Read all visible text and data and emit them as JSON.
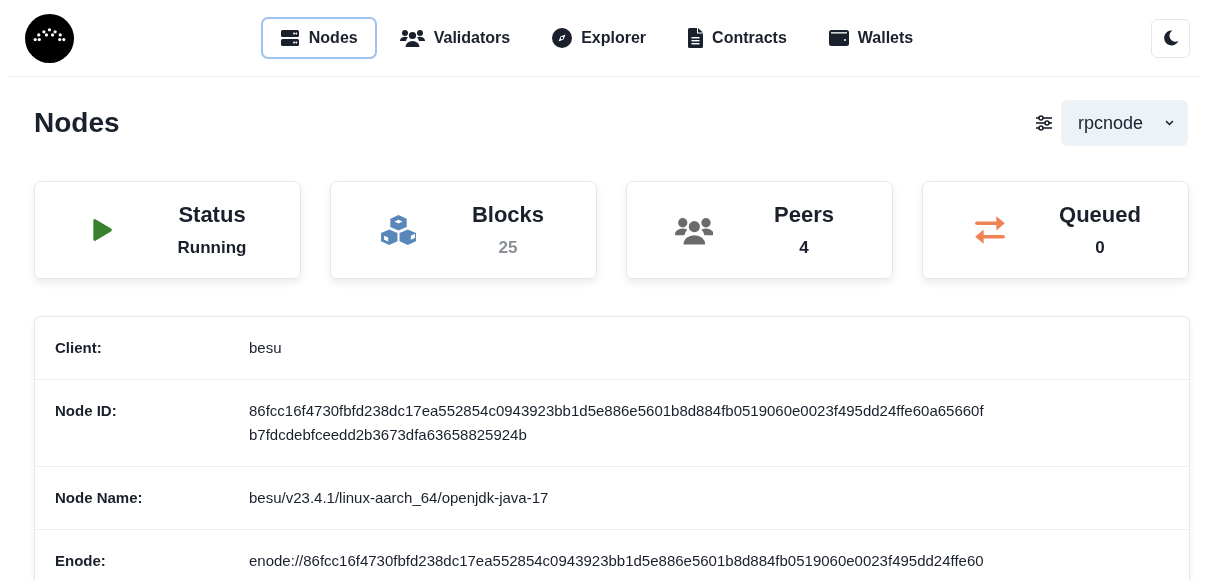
{
  "nav": {
    "items": [
      {
        "label": "Nodes",
        "selected": true
      },
      {
        "label": "Validators",
        "selected": false
      },
      {
        "label": "Explorer",
        "selected": false
      },
      {
        "label": "Contracts",
        "selected": false
      },
      {
        "label": "Wallets",
        "selected": false
      }
    ]
  },
  "page": {
    "title": "Nodes",
    "node_select": {
      "value": "rpcnode"
    }
  },
  "cards": [
    {
      "title": "Status",
      "value": "Running",
      "color": "#38812f",
      "dimmed": false
    },
    {
      "title": "Blocks",
      "value": "25",
      "color": "#5a87b9",
      "dimmed": true
    },
    {
      "title": "Peers",
      "value": "4",
      "color": "#6b6b6b",
      "dimmed": false
    },
    {
      "title": "Queued",
      "value": "0",
      "color": "#ef8354",
      "dimmed": false
    }
  ],
  "details": [
    {
      "label": "Client:",
      "lines": [
        "besu"
      ]
    },
    {
      "label": "Node ID:",
      "lines": [
        "86fcc16f4730fbfd238dc17ea552854c0943923bb1d5e886e5601b8d884fb0519060e0023f495dd24ffe60a65660f",
        "b7fdcdebfceedd2b3673dfa63658825924b"
      ]
    },
    {
      "label": "Node Name:",
      "lines": [
        "besu/v23.4.1/linux-aarch_64/openjdk-java-17"
      ]
    },
    {
      "label": "Enode:",
      "lines": [
        "enode://86fcc16f4730fbfd238dc17ea552854c0943923bb1d5e886e5601b8d884fb0519060e0023f495dd24ffe60"
      ]
    }
  ]
}
